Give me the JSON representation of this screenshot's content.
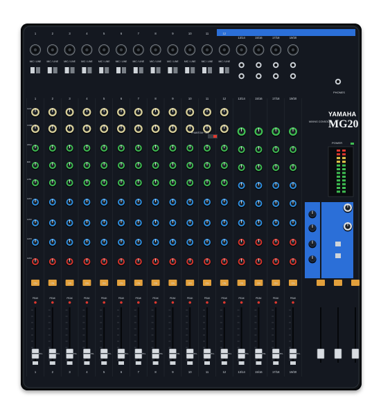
{
  "brand": "YAMAHA",
  "model": "MG20",
  "model_subtitle": "MIXING CONSOLE",
  "mono_channels": [
    "1",
    "2",
    "3",
    "4",
    "5",
    "6",
    "7",
    "8",
    "9",
    "10",
    "11",
    "12"
  ],
  "stereo_channels": [
    "13/14",
    "15/16",
    "17/18",
    "19/20"
  ],
  "input_label": "MIC / LINE",
  "phones_label": "PHONES",
  "power_label": "POWER",
  "phantom_label": "PHANTOM +48V",
  "on_label": "ON",
  "peak_label": "PEAK",
  "pfl_label": "PFL",
  "knob_labels": [
    "GAIN",
    "COMP",
    "HIGH",
    "MID",
    "LOW",
    "AUX1",
    "AUX2",
    "AUX3",
    "AUX4",
    "FX1",
    "FX2",
    "PAN"
  ],
  "colors": {
    "chassis": "#111417",
    "panel_blue": "#2b6fd8",
    "knob_green": "#3fbf52",
    "knob_blue": "#2f8fe0",
    "knob_red": "#d8342c",
    "knob_cream": "#d8cf9a",
    "on_button": "#e2a03c"
  }
}
